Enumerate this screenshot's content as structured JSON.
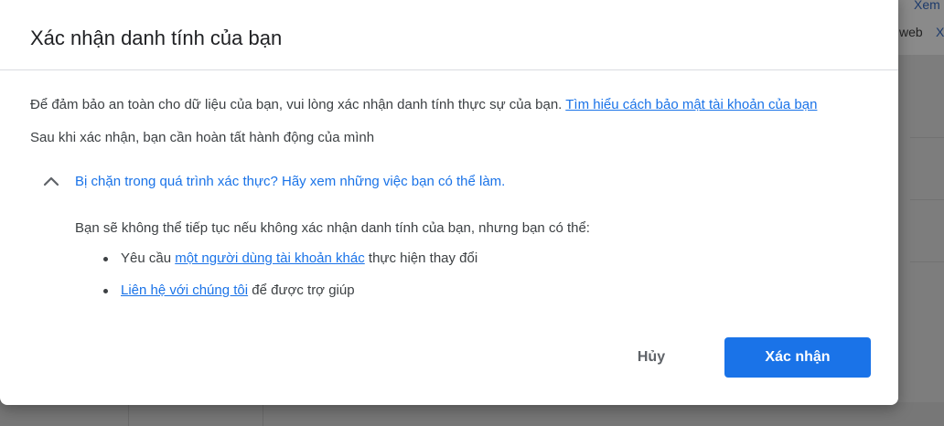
{
  "background": {
    "links": [
      "Xem",
      "web",
      "X"
    ]
  },
  "dialog": {
    "title": "Xác nhận danh tính của bạn",
    "intro_text": "Để đảm bảo an toàn cho dữ liệu của bạn, vui lòng xác nhận danh tính thực sự của bạn.",
    "intro_link": "Tìm hiểu cách bảo mật tài khoản của bạn",
    "subtext": "Sau khi xác nhận, bạn cần hoàn tất hành động của mình",
    "expander": {
      "icon": "chevron-up-icon",
      "label": "Bị chặn trong quá trình xác thực? Hãy xem những việc bạn có thể làm.",
      "expanded": true
    },
    "panel_text": "Bạn sẽ không thể tiếp tục nếu không xác nhận danh tính của bạn, nhưng bạn có thể:",
    "options": [
      {
        "prefix": "Yêu cầu",
        "link": "một người dùng tài khoản khác",
        "suffix": "thực hiện thay đổi"
      },
      {
        "prefix": "",
        "link": "Liên hệ với chúng tôi",
        "suffix": "để được trợ giúp"
      }
    ],
    "cancel_label": "Hủy",
    "confirm_label": "Xác nhận"
  },
  "colors": {
    "accent": "#1a73e8",
    "text": "#3c4043",
    "title": "#202124",
    "scrim": "#7b7b7b"
  }
}
